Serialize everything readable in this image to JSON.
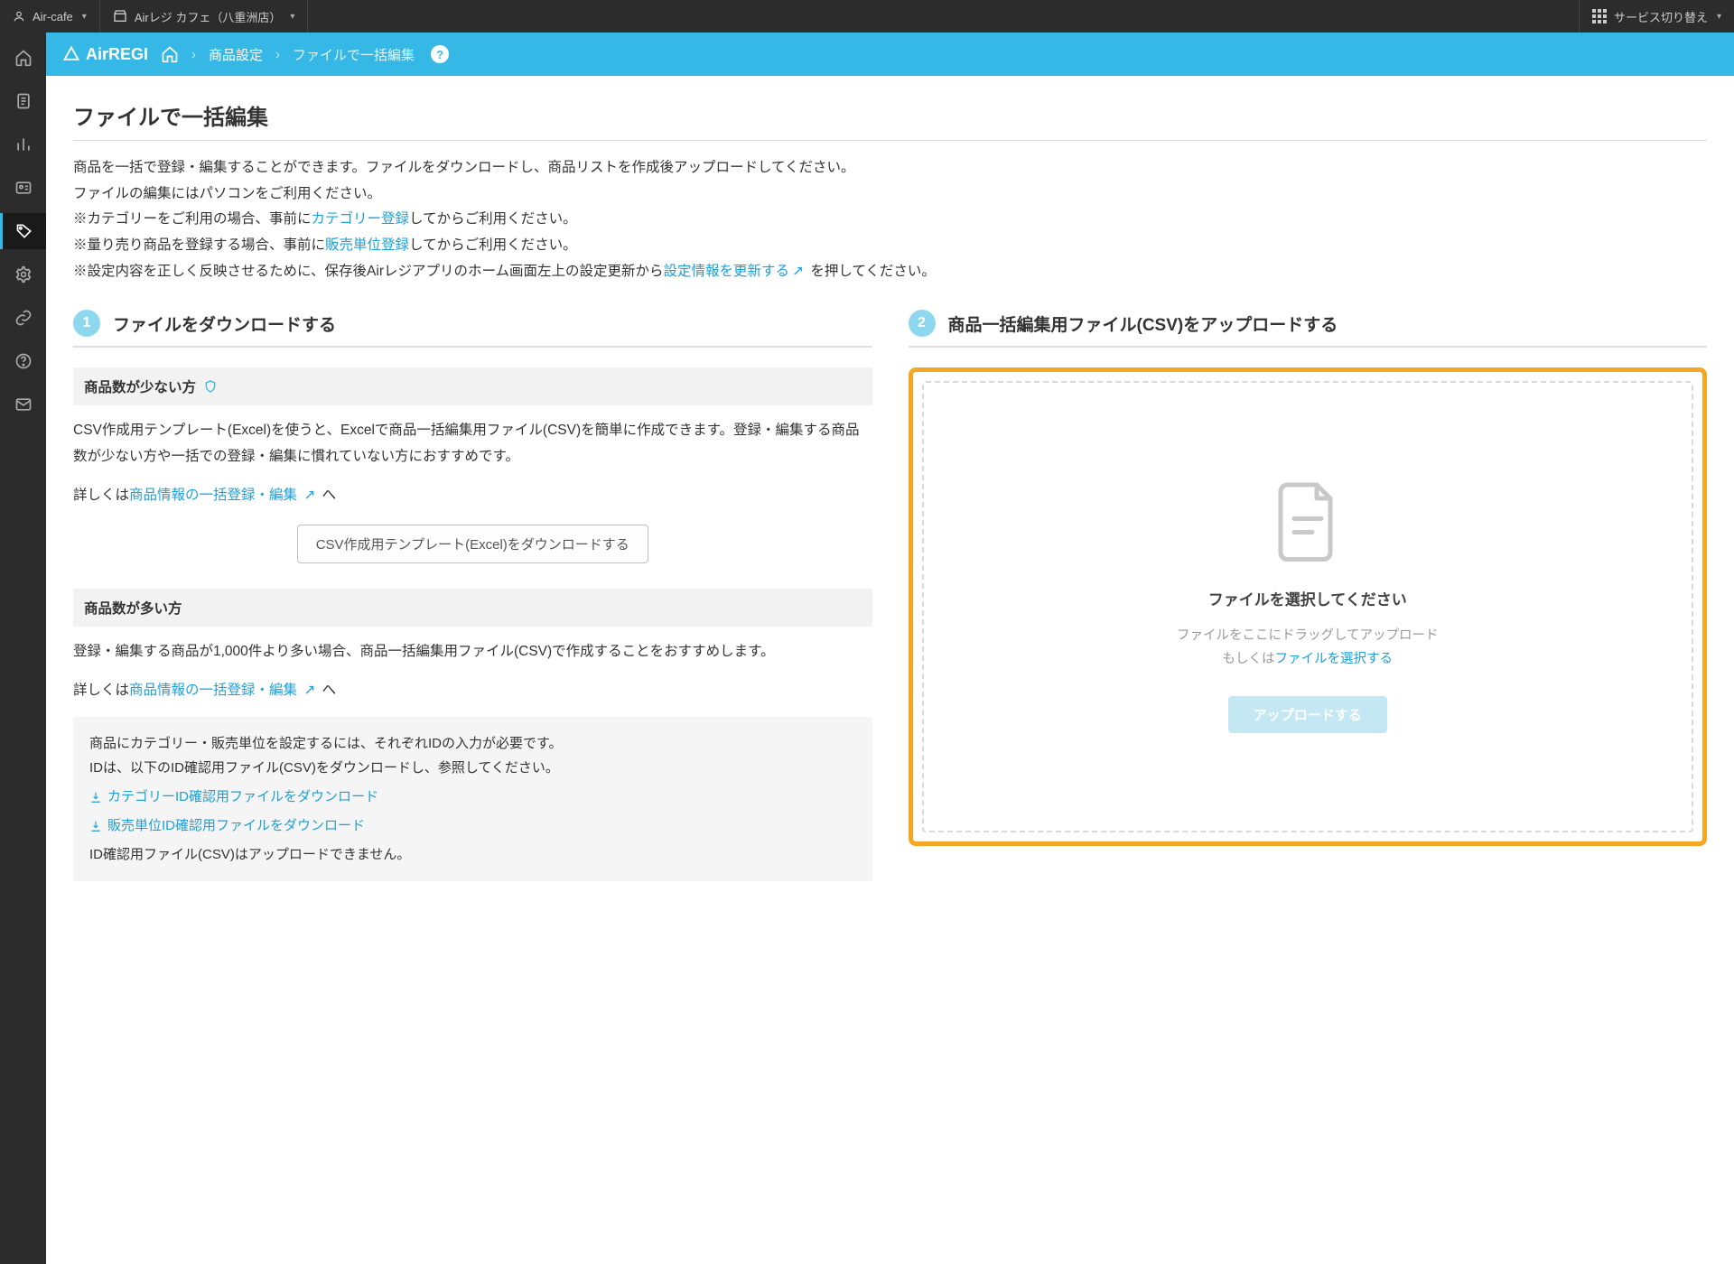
{
  "topbar": {
    "account": "Air-cafe",
    "store": "Airレジ カフェ（八重洲店）",
    "service_switch": "サービス切り替え"
  },
  "brand": "AirREGI",
  "breadcrumb": {
    "item1": "商品設定",
    "current": "ファイルで一括編集"
  },
  "page": {
    "title": "ファイルで一括編集",
    "p1": "商品を一括で登録・編集することができます。ファイルをダウンロードし、商品リストを作成後アップロードしてください。",
    "p2": "ファイルの編集にはパソコンをご利用ください。",
    "p3a": "※カテゴリーをご利用の場合、事前に",
    "p3_link": "カテゴリー登録",
    "p3b": "してからご利用ください。",
    "p4a": "※量り売り商品を登録する場合、事前に",
    "p4_link": "販売単位登録",
    "p4b": "してからご利用ください。",
    "p5a": "※設定内容を正しく反映させるために、保存後Airレジアプリのホーム画面左上の設定更新から",
    "p5_link": "設定情報を更新する",
    "p5b": " を押してください。"
  },
  "step1": {
    "num": "1",
    "title": "ファイルをダウンロードする",
    "few_head": "商品数が少ない方",
    "few_p": "CSV作成用テンプレート(Excel)を使うと、Excelで商品一括編集用ファイル(CSV)を簡単に作成できます。登録・編集する商品数が少ない方や一括での登録・編集に慣れていない方におすすめです。",
    "details_prefix": "詳しくは",
    "details_link": "商品情報の一括登録・編集",
    "details_suffix": " へ",
    "dl_btn": "CSV作成用テンプレート(Excel)をダウンロードする",
    "many_head": "商品数が多い方",
    "many_p": "登録・編集する商品が1,000件より多い場合、商品一括編集用ファイル(CSV)で作成することをおすすめします。",
    "info1": "商品にカテゴリー・販売単位を設定するには、それぞれIDの入力が必要です。",
    "info2": "IDは、以下のID確認用ファイル(CSV)をダウンロードし、参照してください。",
    "dl_cat": "カテゴリーID確認用ファイルをダウンロード",
    "dl_unit": "販売単位ID確認用ファイルをダウンロード",
    "info3": "ID確認用ファイル(CSV)はアップロードできません。"
  },
  "step2": {
    "num": "2",
    "title": "商品一括編集用ファイル(CSV)をアップロードする",
    "dz_title": "ファイルを選択してください",
    "dz_drag": "ファイルをここにドラッグしてアップロード",
    "dz_or": "もしくは",
    "dz_link": "ファイルを選択する",
    "upload_btn": "アップロードする"
  }
}
